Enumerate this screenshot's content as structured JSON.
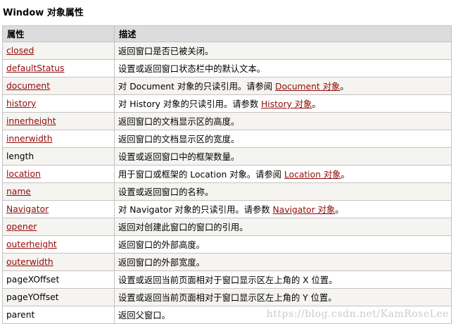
{
  "page_title": "Window 对象属性",
  "header": {
    "col1": "属性",
    "col2": "描述"
  },
  "rows": [
    {
      "prop": "closed",
      "link": true,
      "desc": "返回窗口是否已被关闭。"
    },
    {
      "prop": "defaultStatus",
      "link": true,
      "desc": "设置或返回窗口状态栏中的默认文本。"
    },
    {
      "prop": "document",
      "link": true,
      "desc": "对 Document 对象的只读引用。请参阅 ",
      "ref": "Document 对象",
      "tail": "。"
    },
    {
      "prop": "history",
      "link": true,
      "desc": "对 History 对象的只读引用。请参数 ",
      "ref": "History 对象",
      "tail": "。"
    },
    {
      "prop": "innerheight",
      "link": true,
      "desc": "返回窗口的文档显示区的高度。"
    },
    {
      "prop": "innerwidth",
      "link": true,
      "desc": "返回窗口的文档显示区的宽度。"
    },
    {
      "prop": "length",
      "link": false,
      "desc": "设置或返回窗口中的框架数量。"
    },
    {
      "prop": "location",
      "link": true,
      "desc": "用于窗口或框架的 Location 对象。请参阅 ",
      "ref": "Location 对象",
      "tail": "。"
    },
    {
      "prop": "name",
      "link": true,
      "desc": "设置或返回窗口的名称。"
    },
    {
      "prop": "Navigator",
      "link": true,
      "desc": "对 Navigator 对象的只读引用。请参数 ",
      "ref": "Navigator 对象",
      "tail": "。"
    },
    {
      "prop": "opener",
      "link": true,
      "desc": "返回对创建此窗口的窗口的引用。"
    },
    {
      "prop": "outerheight",
      "link": true,
      "desc": "返回窗口的外部高度。"
    },
    {
      "prop": "outerwidth",
      "link": true,
      "desc": "返回窗口的外部宽度。"
    },
    {
      "prop": "pageXOffset",
      "link": false,
      "desc": "设置或返回当前页面相对于窗口显示区左上角的 X 位置。"
    },
    {
      "prop": "pageYOffset",
      "link": false,
      "desc": "设置或返回当前页面相对于窗口显示区左上角的 Y 位置。"
    },
    {
      "prop": "parent",
      "link": false,
      "desc": "返回父窗口。"
    }
  ],
  "watermark": "https://blog.csdn.net/KamRoseLee",
  "colors": {
    "link": "#900b09",
    "header_bg": "#dcdcdc",
    "row_alt": "#f6f4f0",
    "border": "#c3c3c3"
  }
}
